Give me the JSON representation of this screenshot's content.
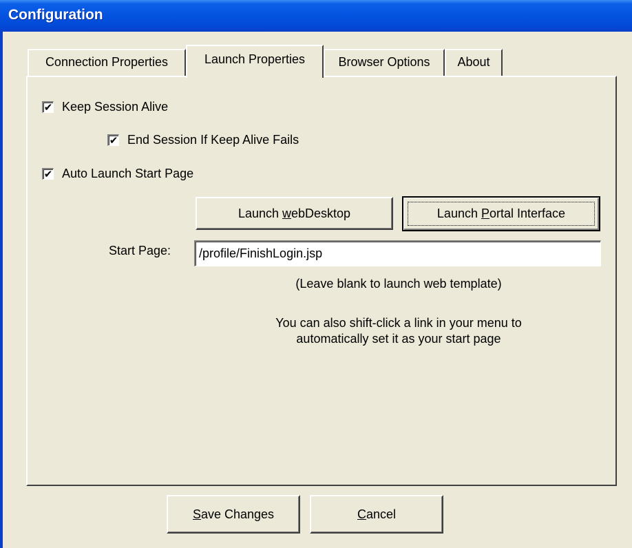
{
  "window": {
    "title": "Configuration"
  },
  "tabs": [
    {
      "label": "Connection Properties",
      "active": false
    },
    {
      "label": "Launch Properties",
      "active": true
    },
    {
      "label": "Browser Options",
      "active": false
    },
    {
      "label": "About",
      "active": false
    }
  ],
  "launch_properties": {
    "keep_session_alive": {
      "label": "Keep Session Alive",
      "checked": true
    },
    "end_session_if_keep_alive_fails": {
      "label": "End Session If Keep Alive Fails",
      "checked": true
    },
    "auto_launch_start_page": {
      "label": "Auto Launch Start Page",
      "checked": true
    },
    "launch_webdesktop_button": {
      "prefix": "Launch ",
      "mnemonic": "w",
      "suffix": "ebDesktop"
    },
    "launch_portal_button": {
      "prefix": "Launch ",
      "mnemonic": "P",
      "suffix": "ortal Interface"
    },
    "start_page_label": "Start Page:",
    "start_page_value": "/profile/FinishLogin.jsp",
    "blank_hint": "(Leave blank to launch web template)",
    "shift_click_hint_line1": "You can also shift-click a link in your menu to",
    "shift_click_hint_line2": "automatically set it as your start page"
  },
  "footer": {
    "save_button": {
      "mnemonic": "S",
      "suffix": "ave Changes"
    },
    "cancel_button": {
      "mnemonic": "C",
      "suffix": "ancel"
    }
  },
  "colors": {
    "titlebar": "#0553e1",
    "dialog_background": "#ece9d8"
  }
}
